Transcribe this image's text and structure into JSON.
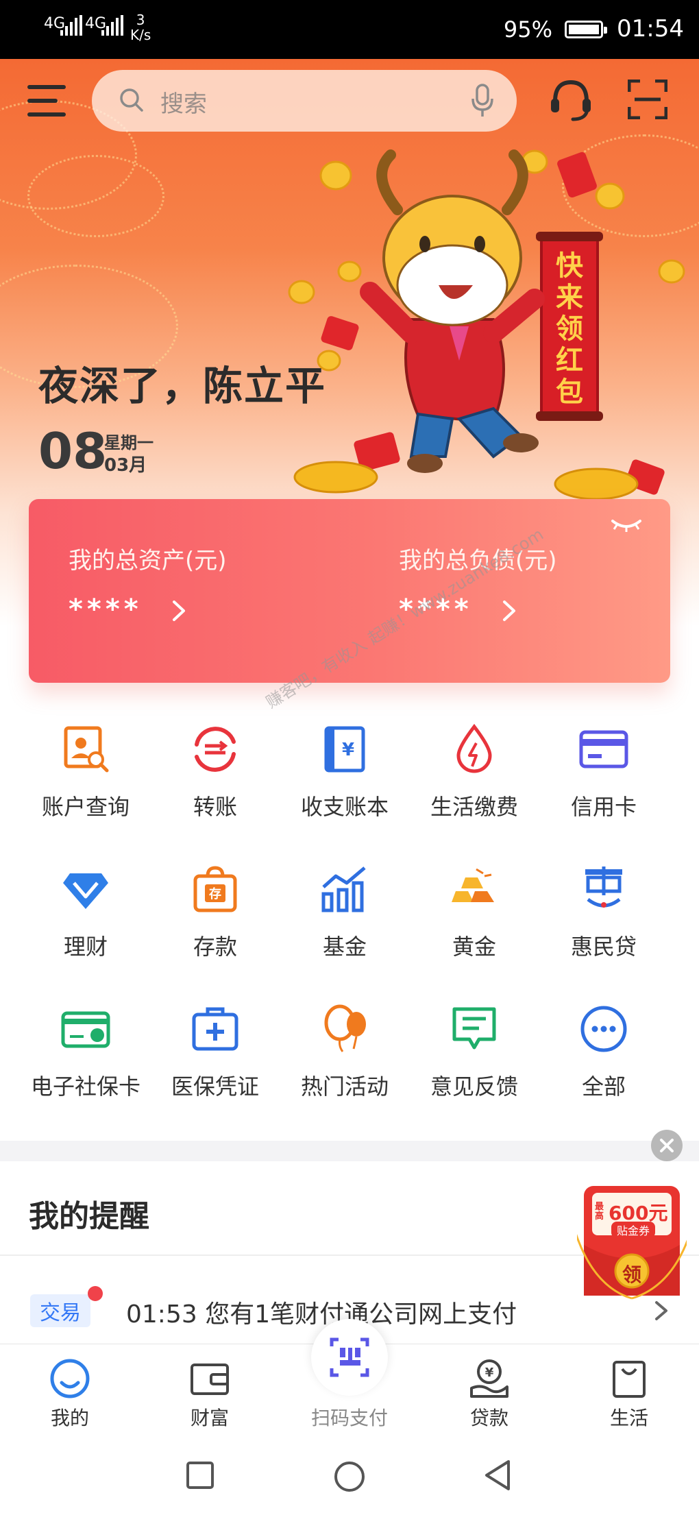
{
  "status_bar": {
    "signal_1": "4G",
    "signal_2": "4G",
    "speed_value": "3",
    "speed_unit": "K/s",
    "battery_percent": "95%",
    "time": "01:54"
  },
  "header": {
    "search_placeholder": "搜索"
  },
  "hero": {
    "greeting": "夜深了，陈立平",
    "day": "08",
    "weekday": "星期一",
    "month": "03月",
    "banner_text": "快来领红包"
  },
  "assets": {
    "total_assets_label": "我的总资产(元)",
    "total_assets_value": "****",
    "total_liabilities_label": "我的总负债(元)",
    "total_liabilities_value": "****"
  },
  "grid": [
    {
      "label": "账户查询",
      "icon": "account-query-icon"
    },
    {
      "label": "转账",
      "icon": "transfer-icon"
    },
    {
      "label": "收支账本",
      "icon": "ledger-icon"
    },
    {
      "label": "生活缴费",
      "icon": "bill-payment-icon"
    },
    {
      "label": "信用卡",
      "icon": "credit-card-icon"
    },
    {
      "label": "理财",
      "icon": "wealth-diamond-icon"
    },
    {
      "label": "存款",
      "icon": "deposit-bag-icon"
    },
    {
      "label": "基金",
      "icon": "fund-chart-icon"
    },
    {
      "label": "黄金",
      "icon": "gold-bars-icon"
    },
    {
      "label": "惠民贷",
      "icon": "huimin-loan-icon"
    },
    {
      "label": "电子社保卡",
      "icon": "social-security-card-icon"
    },
    {
      "label": "医保凭证",
      "icon": "medical-kit-icon"
    },
    {
      "label": "热门活动",
      "icon": "balloon-icon"
    },
    {
      "label": "意见反馈",
      "icon": "feedback-icon"
    },
    {
      "label": "全部",
      "icon": "more-dots-icon"
    }
  ],
  "watermark": "赚客吧，有收入 起赚！www.zuanke8.com",
  "reminder": {
    "title": "我的提醒",
    "tag": "交易",
    "text": "01:53 您有1笔财付通公司网上支付"
  },
  "coupon": {
    "amount": "600元",
    "prefix": "最高",
    "subtitle": "贴金券",
    "button": "领"
  },
  "bottom_nav": [
    {
      "label": "我的",
      "icon": "my-icon"
    },
    {
      "label": "财富",
      "icon": "wallet-icon"
    },
    {
      "label": "扫码支付",
      "icon": "scan-pay-icon"
    },
    {
      "label": "贷款",
      "icon": "loan-icon"
    },
    {
      "label": "生活",
      "icon": "shopping-bag-icon"
    }
  ],
  "colors": {
    "accent_blue": "#3478f6",
    "brand_orange": "#f46a34",
    "card_red": "#f75b66",
    "gold": "#f7b52c"
  }
}
